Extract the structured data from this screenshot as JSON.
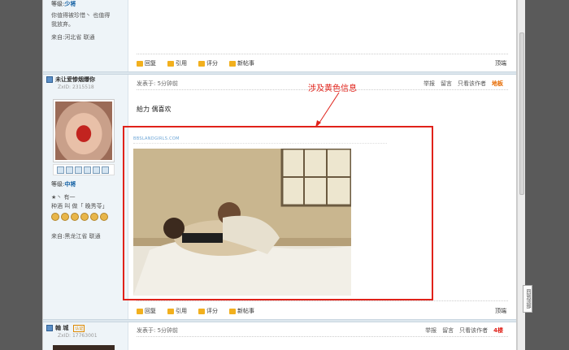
{
  "post_prev": {
    "level_label": "等级:",
    "level_value": "少将",
    "signature_1": "你值得被珍惜丶  也值得",
    "signature_2": "我放弃。",
    "location": "来自:河北省 联通"
  },
  "toolbar": {
    "reply": "回复",
    "quote": "引用",
    "rate": "评分",
    "new_post": "新帖事",
    "top": "顶端"
  },
  "post_main": {
    "username": "未让爱惨烟爆你",
    "uid": "ZxID: 2315518",
    "level_label": "等级:",
    "level_value": "中将",
    "bio_1": "★丶             有一",
    "bio_2": "种酒 叫 做「 晚秀苓」",
    "location": "来自:黑龙江省 联通",
    "posted": "发表于: 5分钟前",
    "actions": [
      "举报",
      "留言",
      "只看该作者"
    ],
    "floor": "地板",
    "message": "給力 偶喜欢",
    "watermark": "BBSLANDGIRLS.COM"
  },
  "annotation": "涉及黄色信息",
  "post_next": {
    "username": "翰 城",
    "badge": "认证",
    "uid": "ZxID: 17763001",
    "posted": "发表于: 5分钟前",
    "actions": [
      "举报",
      "留言",
      "只看该作者"
    ],
    "floor": "4楼"
  },
  "float_tab": "回到顶部",
  "colors": {
    "accent_red": "#e0221a",
    "floor_orange": "#e66a00",
    "level_blue": "#0a5aa0"
  }
}
